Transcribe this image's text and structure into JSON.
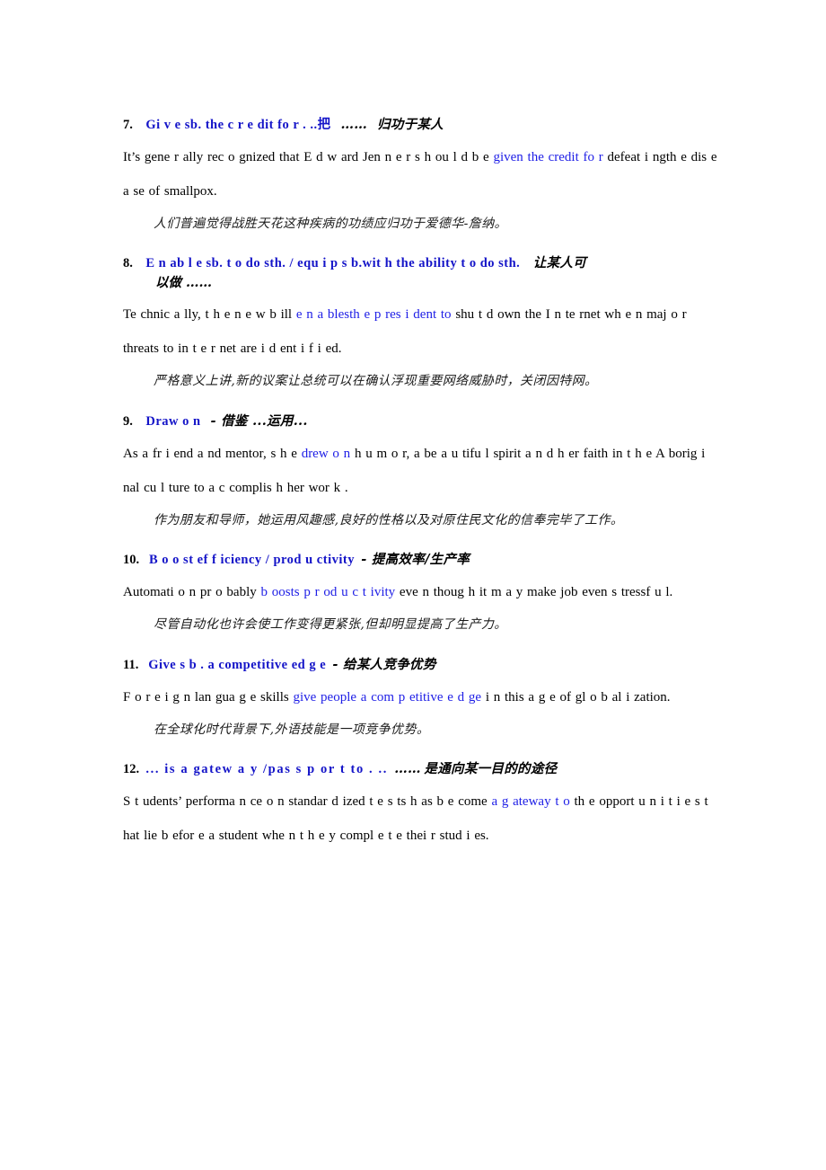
{
  "document": {
    "type": "english-phrase-study-notes",
    "accent_blue": "#1414c8",
    "text_black": "#000000",
    "entries": [
      {
        "number": "7.",
        "phrase_en": "Gi v e sb.   the c r  e dit fo r  . ..把",
        "ellipsis": "……",
        "phrase_cn": "归功于某人",
        "heading_continuation": "",
        "example_pre": "It’s gene r  ally rec o gnized that  E d  w ard Jen n  e r   s h ou l  d   b e  ",
        "example_hl1": "given",
        "example_mid": "   ",
        "example_hl2": "the credit fo r",
        "example_post": " defeat i  ngth e   dis e a se   of   smallpox.",
        "translation": "人们普遍觉得战胜天花这种疾病的功绩应归功于爱德华-詹纳。"
      },
      {
        "number": "8.",
        "phrase_en": "E n ab l e   sb.  t o   do sth. / equ i p   s b.wit h    the ability t o    do sth.",
        "ellipsis": "",
        "phrase_cn": "让某人可",
        "heading_continuation": "以做 ……",
        "example_pre": "Te chnic a lly,    t h e  n e w  b ill ",
        "example_hl1": "e n a blesth e   p res i dent to",
        "example_mid": "",
        "example_hl2": "",
        "example_post": " shu t   d own   the   I n te rnet wh e  n   maj o r    threats to in t  e r net   are i d ent i f i  ed.",
        "translation": "严格意义上讲,新的议案让总统可以在确认浮现重要网络威胁时，关闭因特网。"
      },
      {
        "number": "9.",
        "phrase_en": "Draw  o n",
        "ellipsis": "",
        "phrase_cn": "-  借鉴   ...运用...",
        "heading_continuation": "",
        "example_pre": "As a fr  i  end   a nd  mentor, s h e ",
        "example_hl1": "drew   o n",
        "example_mid": "",
        "example_hl2": "",
        "example_post": " h u m o r,   a be a u tifu l     spirit  a n d  h er faith in t h e   A borig i  nal cu l ture   to a c complis h   her    wor k .",
        "translation": "作为朋友和导师，她运用风趣感,良好的性格以及对原住民文化的信奉完毕了工作。"
      },
      {
        "number": "10.",
        "phrase_en": "B o o st ef f iciency   /    prod u ctivity",
        "ellipsis": "",
        "phrase_cn": "- 提高效率/生产率",
        "heading_continuation": "",
        "example_pre": "Automati o n pr o bably  ",
        "example_hl1": "b oosts",
        "example_mid": "    ",
        "example_hl2": "p r od u  c  t ivity",
        "example_post": " eve n     thoug h   it   m a y make    job even  s tressf u l.",
        "translation": "尽管自动化也许会使工作变得更紧张,但却明显提高了生产力。"
      },
      {
        "number": "11.",
        "phrase_en": "Give   s b .   a competitive ed g  e",
        "ellipsis": "",
        "phrase_cn": "- 给某人竞争优势",
        "heading_continuation": "",
        "example_pre": "F o r e i g n lan gua g e   skills ",
        "example_hl1": "give people   a   com p etitive e d ge",
        "example_mid": "",
        "example_hl2": "",
        "example_post": "  i n this   a g e of   gl o b al i zation.",
        "translation": "在全球化时代背景下,外语技能是一项竞争优势。"
      },
      {
        "number": "12.",
        "phrase_en": "...   is a   gatew a y /pas s p or t   to . ..",
        "ellipsis": "……",
        "phrase_cn": "是通向某一目的的途径",
        "heading_continuation": "",
        "example_pre": "S t udents’   performa n ce o n   standar d ized t e  s ts  h as b e come   ",
        "example_hl1": "a   g ateway  t o",
        "example_mid": "",
        "example_hl2": "",
        "example_post": "   th e opport u n i t i  e s   t hat lie  b efor e    a student whe n  t h e y   compl e t e  thei r   stud i es.",
        "translation": ""
      }
    ]
  }
}
